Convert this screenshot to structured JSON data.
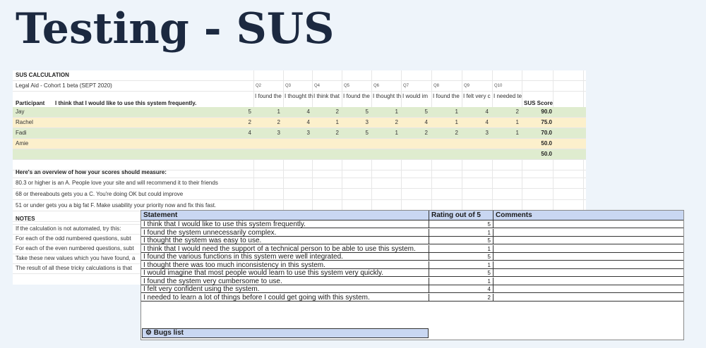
{
  "page_title": "Testing - SUS",
  "calc_sheet": {
    "heading": "SUS CALCULATION",
    "subheading": "Legal Aid - Cohort 1 beta (SEPT 2020)",
    "question_codes": [
      "Q2",
      "Q3",
      "Q4",
      "Q5",
      "Q6",
      "Q7",
      "Q8",
      "Q9",
      "Q10"
    ],
    "question_snippets": [
      "I found the",
      "I thought th",
      "I think that",
      "I found the",
      "I thought th",
      "I would im",
      "I found the",
      "I felt very c",
      "I needed te"
    ],
    "participant_header": "Participant",
    "q1_text": "I think that I would like to use this system frequently.",
    "score_header": "SUS Score",
    "participants": [
      {
        "name": "Jay",
        "ratings": [
          "5",
          "1",
          "4",
          "2",
          "5",
          "1",
          "5",
          "1",
          "4",
          "2"
        ],
        "score": "90.0",
        "color": "green"
      },
      {
        "name": "Rachel",
        "ratings": [
          "2",
          "2",
          "4",
          "1",
          "3",
          "2",
          "4",
          "1",
          "4",
          "1"
        ],
        "score": "75.0",
        "color": "yellow"
      },
      {
        "name": "Fadi",
        "ratings": [
          "4",
          "3",
          "3",
          "2",
          "5",
          "1",
          "2",
          "2",
          "3",
          "1"
        ],
        "score": "70.0",
        "color": "green"
      },
      {
        "name": "Amie",
        "ratings": [
          "",
          "",
          "",
          "",
          "",
          "",
          "",
          "",
          "",
          ""
        ],
        "score": "50.0",
        "color": "yellow"
      },
      {
        "name": "",
        "ratings": [
          "",
          "",
          "",
          "",
          "",
          "",
          "",
          "",
          "",
          ""
        ],
        "score": "50.0",
        "color": "green"
      }
    ],
    "overview_heading": "Here's an overview of how your scores should measure:",
    "overview_lines": [
      "80.3 or higher is an A. People love your site and will recommend it to their friends",
      "68 or thereabouts gets you a C. You're doing OK but could improve",
      "51 or under gets you a big fat F. Make usability your priority now and fix this fast."
    ],
    "notes_heading": "NOTES",
    "notes_lines": [
      "If the calculation is not automated, try this:",
      "For each of the odd numbered questions, subt",
      "For each of the even numbered questions, subt",
      "Take these new values which you have found, a",
      "The result of all these tricky calculations is that"
    ]
  },
  "statement_sheet": {
    "headers": {
      "statement": "Statement",
      "rating": "Rating out of 5",
      "comments": "Comments"
    },
    "rows": [
      {
        "statement": "I think that I would like to use this system frequently.",
        "rating": "5"
      },
      {
        "statement": "I found the system unnecessarily complex.",
        "rating": "1"
      },
      {
        "statement": "I thought the system was easy to use.",
        "rating": "5"
      },
      {
        "statement": "I think that I would need the support of a technical person to be able to use this system.",
        "rating": "1"
      },
      {
        "statement": "I found the various functions in this system were well integrated.",
        "rating": "5"
      },
      {
        "statement": "I thought there was too much inconsistency in this system.",
        "rating": "1"
      },
      {
        "statement": "I would imagine that most people would learn to use this system very quickly.",
        "rating": "5"
      },
      {
        "statement": "I found the system very cumbersome to use.",
        "rating": "1"
      },
      {
        "statement": "I felt very confident using the system.",
        "rating": "4"
      },
      {
        "statement": "I needed to learn a lot of things before I could get going with this system.",
        "rating": "2"
      }
    ],
    "bugs_label": "Bugs list",
    "bugs_icon": "bug-icon"
  }
}
